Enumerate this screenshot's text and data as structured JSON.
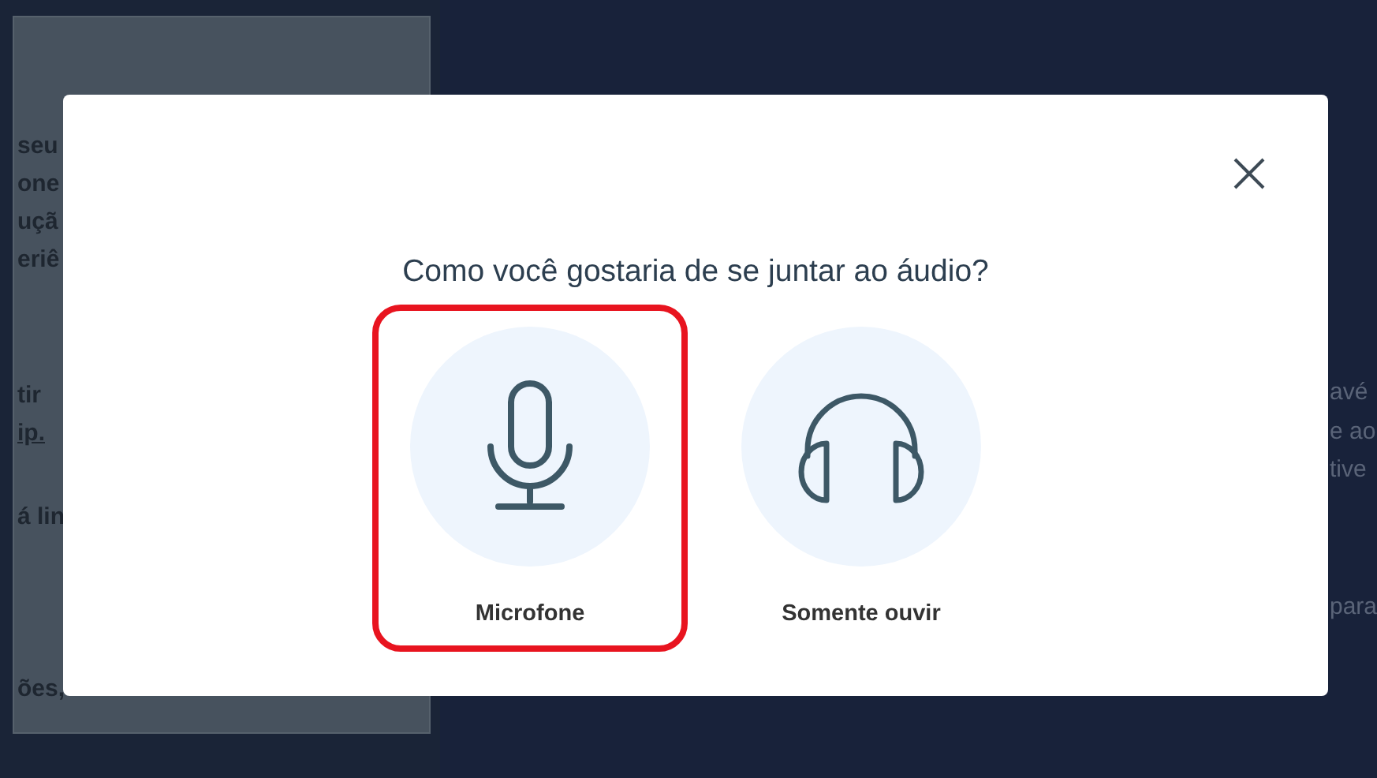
{
  "background_left_panel": {
    "lines": [
      {
        "text": "seu",
        "link": false
      },
      {
        "text": "one",
        "link": false
      },
      {
        "text": "uçã",
        "link": false
      },
      {
        "text": "eriê",
        "link": false
      },
      {
        "text": "tir",
        "link": false
      },
      {
        "text": "ip.",
        "link": true
      },
      {
        "text": "á lin",
        "link": false
      },
      {
        "text": "ões,",
        "link": false
      }
    ]
  },
  "background_right_panel": {
    "lines": [
      "avé",
      "e ao",
      "tive",
      "para"
    ]
  },
  "dialog": {
    "title": "Como você gostaria de se juntar ao áudio?",
    "options": [
      {
        "kind": "microphone",
        "label": "Microfone",
        "selected": true
      },
      {
        "kind": "listen",
        "label": "Somente ouvir",
        "selected": false
      }
    ]
  }
}
